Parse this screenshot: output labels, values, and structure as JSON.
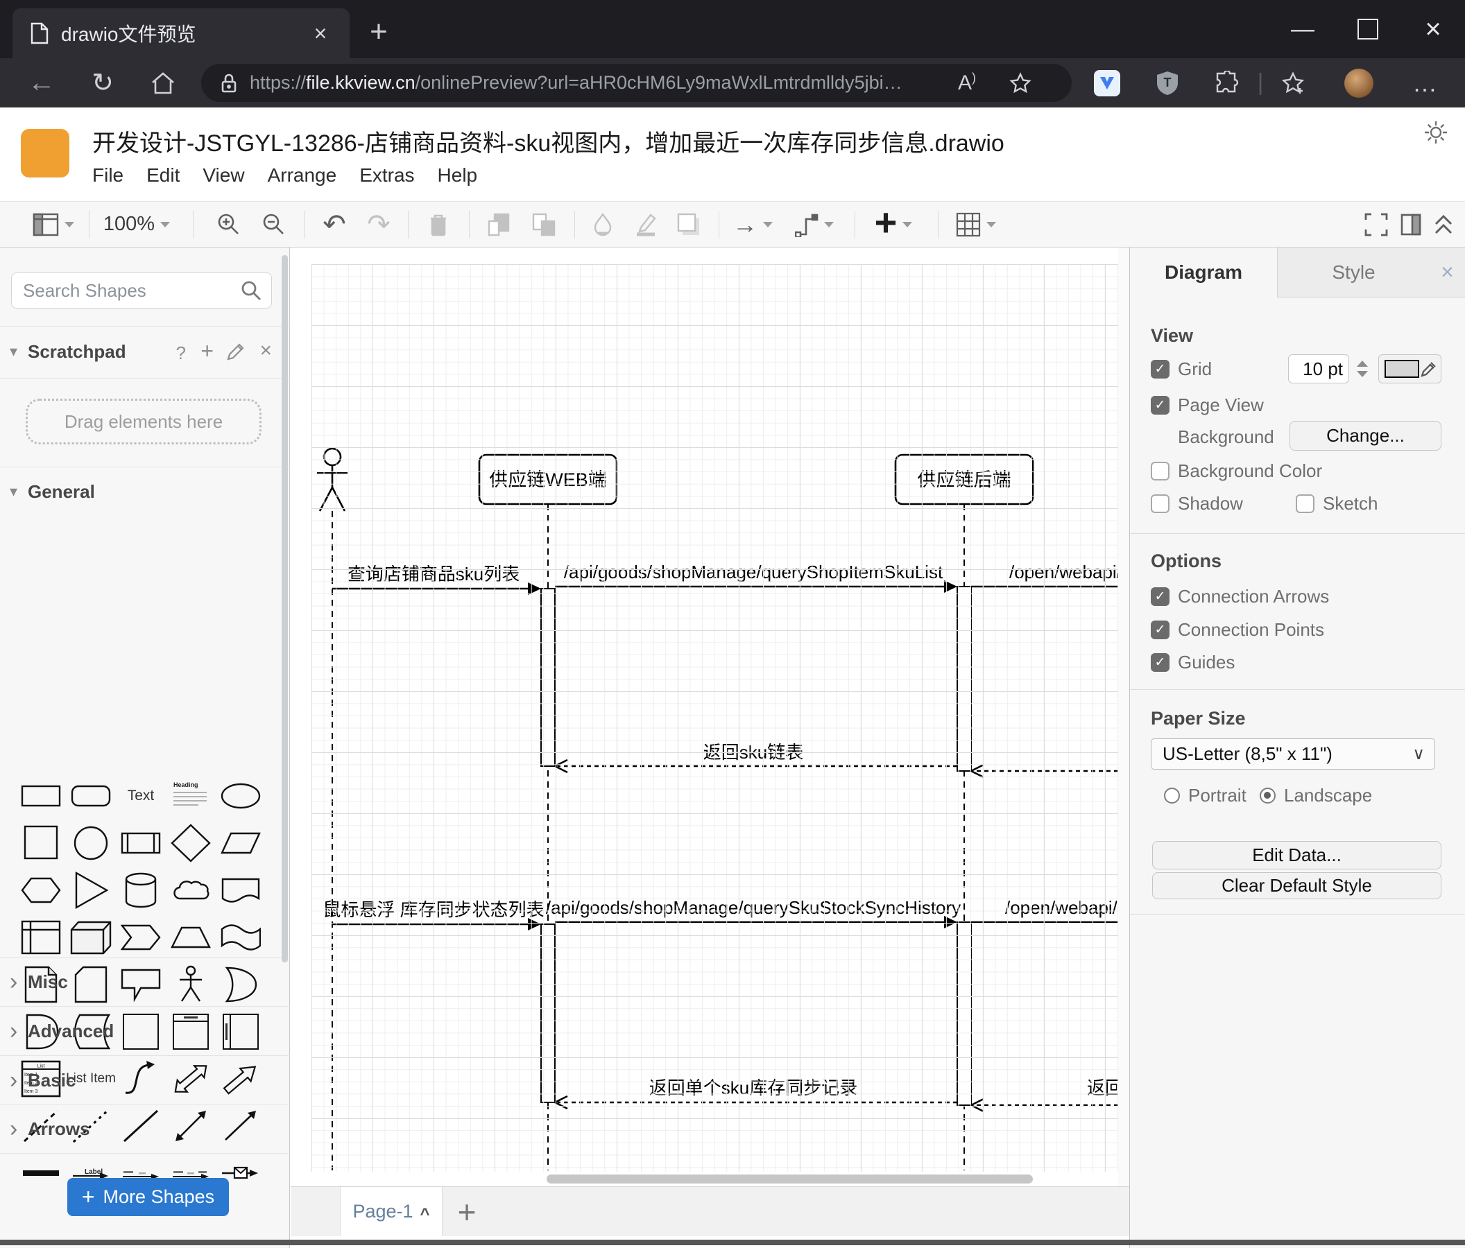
{
  "icons": {
    "close": "×",
    "plus": "+",
    "back_arrow": "←",
    "refresh": "↻",
    "more": "…",
    "caret_up": "^",
    "chevron_right": "›",
    "triangle_down": "▾",
    "check": "✓",
    "question": "?",
    "reader_a": "A",
    "reader_paren": ")",
    "arrow_right": "→",
    "undo": "↶",
    "redo": "↷",
    "kebab": "⋮",
    "minimize": "—",
    "select_caret": "∨"
  },
  "browser": {
    "tab_title": "drawio文件预览",
    "url": {
      "scheme": "https://",
      "host": "file.kkview.cn",
      "path": "/onlinePreview?url=aHR0cHM6Ly9maWxlLmtrdmlldy5jbi…"
    }
  },
  "app": {
    "title": "开发设计-JSTGYL-13286-店铺商品资料-sku视图内，增加最近一次库存同步信息.drawio",
    "menus": [
      "File",
      "Edit",
      "View",
      "Arrange",
      "Extras",
      "Help"
    ],
    "toolbar": {
      "zoom": "100%"
    }
  },
  "sidebar": {
    "search_placeholder": "Search Shapes",
    "scratchpad": "Scratchpad",
    "drag_hint": "Drag elements here",
    "sections": {
      "general": "General",
      "misc": "Misc",
      "advanced": "Advanced",
      "basic": "Basic",
      "arrows": "Arrows"
    },
    "shape_texts": {
      "text": "Text",
      "heading": "Heading",
      "list": "List",
      "item1": "Item 1",
      "item2": "Item 2",
      "item3": "Item 3",
      "list_item": "List Item",
      "label": "Label"
    },
    "more_shapes": "More Shapes"
  },
  "diagram": {
    "participants": [
      "供应链WEB端",
      "供应链后端"
    ],
    "messages": {
      "m1": "查询店铺商品sku列表",
      "m2": "/api/goods/shopManage/queryShopItemSkuList",
      "m3": "/open/webapi/",
      "r1": "返回sku链表",
      "m4": "鼠标悬浮 库存同步状态列表",
      "m5": "/api/goods/shopManage/querySkuStockSyncHistory",
      "m6": "/open/webapi/iten",
      "r2": "返回单个sku库存同步记录",
      "r3": "返回"
    }
  },
  "panel": {
    "tabs": {
      "diagram": "Diagram",
      "style": "Style"
    },
    "view": {
      "heading": "View",
      "grid": "Grid",
      "grid_size": "10 pt",
      "page_view": "Page View",
      "background": "Background",
      "change": "Change...",
      "background_color": "Background Color",
      "shadow": "Shadow",
      "sketch": "Sketch"
    },
    "options": {
      "heading": "Options",
      "connection_arrows": "Connection Arrows",
      "connection_points": "Connection Points",
      "guides": "Guides"
    },
    "paper": {
      "heading": "Paper Size",
      "size": "US-Letter (8,5\" x 11\")",
      "portrait": "Portrait",
      "landscape": "Landscape"
    },
    "buttons": {
      "edit_data": "Edit Data...",
      "clear_default_style": "Clear Default Style"
    }
  },
  "footer": {
    "page_tab": "Page-1"
  },
  "colors": {
    "accent_blue": "#2a78d0",
    "logo_orange": "#f0a030",
    "grid_minor": "#eeeeee",
    "grid_major": "#dcdcdc"
  }
}
